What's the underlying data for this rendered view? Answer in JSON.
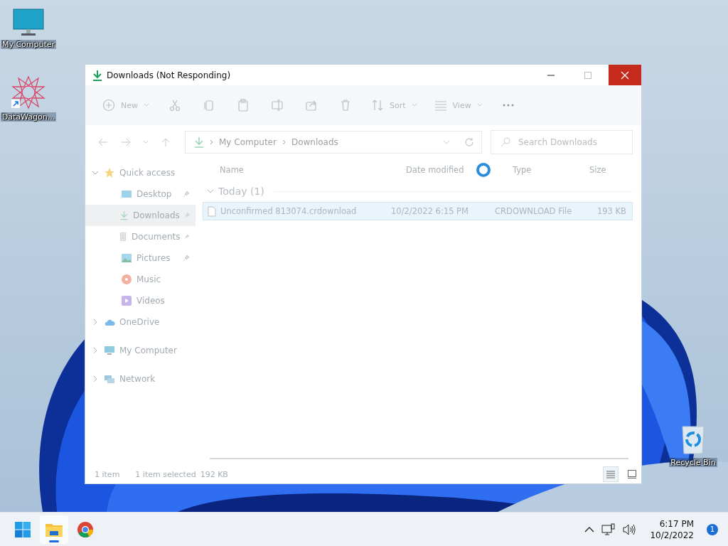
{
  "desktop_icons": [
    {
      "label": "My Computer",
      "kind": "computer"
    },
    {
      "label": "DataWagon...",
      "kind": "shortcut"
    },
    {
      "label": "Recycle Bin",
      "kind": "recycle"
    }
  ],
  "window": {
    "title": "Downloads (Not Responding)",
    "toolbar": [
      {
        "kind": "new",
        "label": "New",
        "dropdown": true
      },
      {
        "kind": "cut"
      },
      {
        "kind": "copy"
      },
      {
        "kind": "paste"
      },
      {
        "kind": "rename"
      },
      {
        "kind": "share"
      },
      {
        "kind": "delete"
      },
      {
        "kind": "sort",
        "label": "Sort",
        "dropdown": true
      },
      {
        "kind": "view",
        "label": "View",
        "dropdown": true
      },
      {
        "kind": "more"
      }
    ],
    "address": {
      "path": [
        "My Computer",
        "Downloads"
      ]
    },
    "search": {
      "placeholder": "Search Downloads"
    },
    "sidebar": {
      "items": [
        {
          "label": "Quick access",
          "kind": "star",
          "expanded": true,
          "selected": false,
          "children": [
            {
              "label": "Desktop",
              "kind": "desktop",
              "pinned": true,
              "selected": false
            },
            {
              "label": "Downloads",
              "kind": "download",
              "pinned": true,
              "selected": true
            },
            {
              "label": "Documents",
              "kind": "document",
              "pinned": true,
              "selected": false
            },
            {
              "label": "Pictures",
              "kind": "pictures",
              "pinned": true,
              "selected": false
            },
            {
              "label": "Music",
              "kind": "music",
              "pinned": false,
              "selected": false
            },
            {
              "label": "Videos",
              "kind": "videos",
              "pinned": false,
              "selected": false
            }
          ]
        },
        {
          "label": "OneDrive",
          "kind": "cloud",
          "expanded": false,
          "selected": false
        },
        {
          "label": "My Computer",
          "kind": "computer",
          "expanded": false,
          "selected": false
        },
        {
          "label": "Network",
          "kind": "network",
          "expanded": false,
          "selected": false
        }
      ]
    },
    "columns": [
      "Name",
      "Date modified",
      "Type",
      "Size"
    ],
    "groups": [
      {
        "label": "Today (1)",
        "expanded": true,
        "files": [
          {
            "name": "Unconfirmed 813074.crdownload",
            "date": "10/2/2022 6:15 PM",
            "type": "CRDOWNLOAD File",
            "size": "193 KB",
            "selected": true
          }
        ]
      }
    ],
    "status_bar": {
      "count": "1 item",
      "selection": "1 item selected",
      "selection_size": "192 KB",
      "views": [
        {
          "kind": "details",
          "selected": true
        },
        {
          "kind": "tiles",
          "selected": false
        }
      ]
    }
  },
  "taskbar": {
    "apps": [
      {
        "kind": "start",
        "active": false
      },
      {
        "kind": "explorer",
        "active": true
      },
      {
        "kind": "chrome",
        "active": false
      }
    ],
    "time": "6:17 PM",
    "date": "10/2/2022",
    "notifications": "1"
  }
}
